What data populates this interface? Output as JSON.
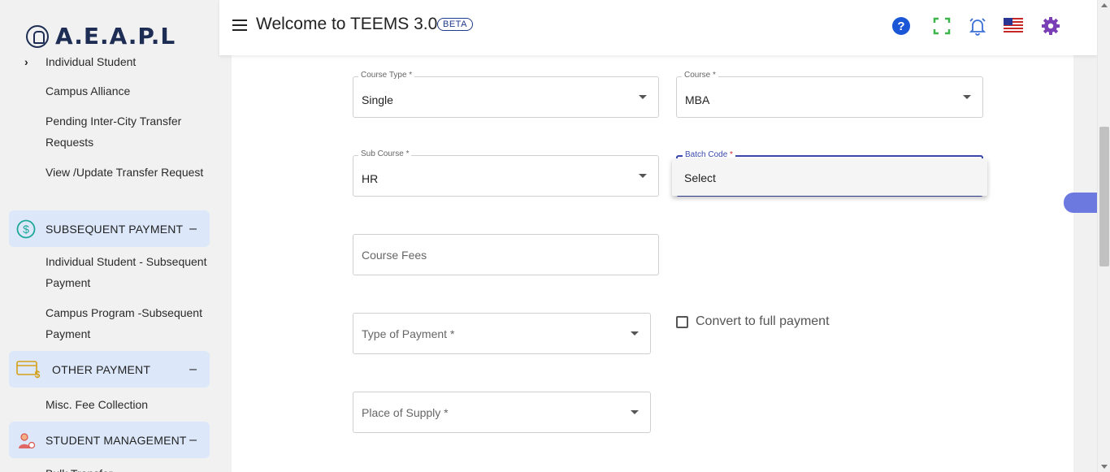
{
  "brand": {
    "logo_text": "A.E.A.P.L"
  },
  "header": {
    "title": "Welcome to TEEMS 3.0",
    "badge": "BETA"
  },
  "sidebar": {
    "items": [
      {
        "label": "Individual Student"
      },
      {
        "label": "Campus Alliance"
      },
      {
        "label": "Pending Inter-City Transfer Requests"
      },
      {
        "label": "View /Update Transfer Request"
      }
    ],
    "groups": {
      "subsequent": {
        "label": "SUBSEQUENT PAYMENT",
        "toggle": "–",
        "items": [
          "Individual Student - Subsequent Payment",
          "Campus Program -Subsequent Payment"
        ]
      },
      "other": {
        "label": "OTHER PAYMENT",
        "toggle": "–",
        "items": [
          "Misc. Fee Collection"
        ]
      },
      "student_mgmt": {
        "label": "STUDENT MANAGEMENT",
        "toggle": "–",
        "items": [
          "Bulk Transfer"
        ]
      }
    }
  },
  "form": {
    "course_type": {
      "label": "Course Type *",
      "value": "Single"
    },
    "course": {
      "label": "Course *",
      "value": "MBA"
    },
    "sub_course": {
      "label": "Sub Course *",
      "value": "HR"
    },
    "batch_code": {
      "label": "Batch Code",
      "required": "*"
    },
    "batch_options": [
      "Select"
    ],
    "course_fees": {
      "placeholder": "Course Fees"
    },
    "type_of_payment": {
      "placeholder": "Type of Payment *"
    },
    "full_payment": {
      "label": "Convert to full payment"
    },
    "place_of_supply": {
      "placeholder": "Place of Supply *"
    }
  },
  "colors": {
    "accent": "#3949ab",
    "sidebar_group_bg": "#dce8fa",
    "float_pill": "#6c7ae0"
  },
  "icons": [
    "hamburger-icon",
    "help-icon",
    "fullscreen-icon",
    "alarm-bell-icon",
    "us-flag-icon",
    "settings-gear-icon",
    "dollar-circle-icon",
    "card-dollar-icon",
    "student-icon"
  ]
}
